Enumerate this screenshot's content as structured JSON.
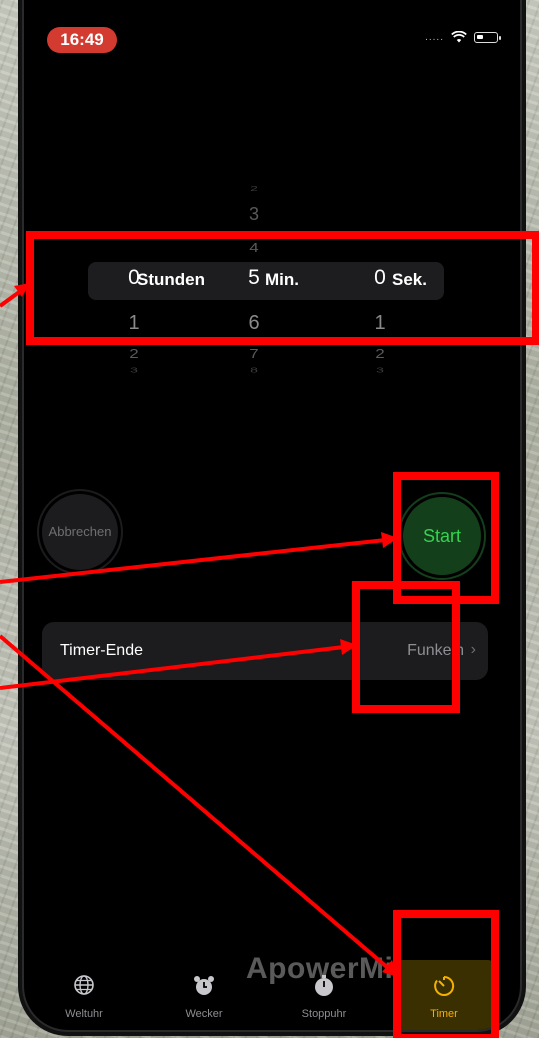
{
  "status_bar": {
    "time": "16:49",
    "signal_dots": "....."
  },
  "picker": {
    "hours": {
      "above": [
        "",
        "",
        ""
      ],
      "selected": "0",
      "below": [
        "1",
        "2",
        "3"
      ],
      "unit": "Stunden"
    },
    "minutes": {
      "above": [
        "2",
        "3",
        "4"
      ],
      "selected": "5",
      "below": [
        "6",
        "7",
        "8"
      ],
      "unit": "Min."
    },
    "seconds": {
      "above": [
        "",
        "",
        ""
      ],
      "selected": "0",
      "below": [
        "1",
        "2",
        "3"
      ],
      "unit": "Sek."
    }
  },
  "buttons": {
    "cancel": "Abbrechen",
    "start": "Start"
  },
  "timer_end": {
    "label": "Timer-Ende",
    "value": "Funkeln",
    "chevron": "›"
  },
  "watermark": "ApowerMirror",
  "tabs": [
    {
      "label": "Weltuhr",
      "icon": "globe-icon"
    },
    {
      "label": "Wecker",
      "icon": "alarm-clock-icon"
    },
    {
      "label": "Stoppuhr",
      "icon": "stopwatch-icon"
    },
    {
      "label": "Timer",
      "icon": "timer-icon",
      "active": true
    }
  ],
  "colors": {
    "start_green": "#35d24f",
    "accent_orange": "#f5b100",
    "annotation_red": "#ff0000",
    "time_pill_red": "#d33a30"
  }
}
